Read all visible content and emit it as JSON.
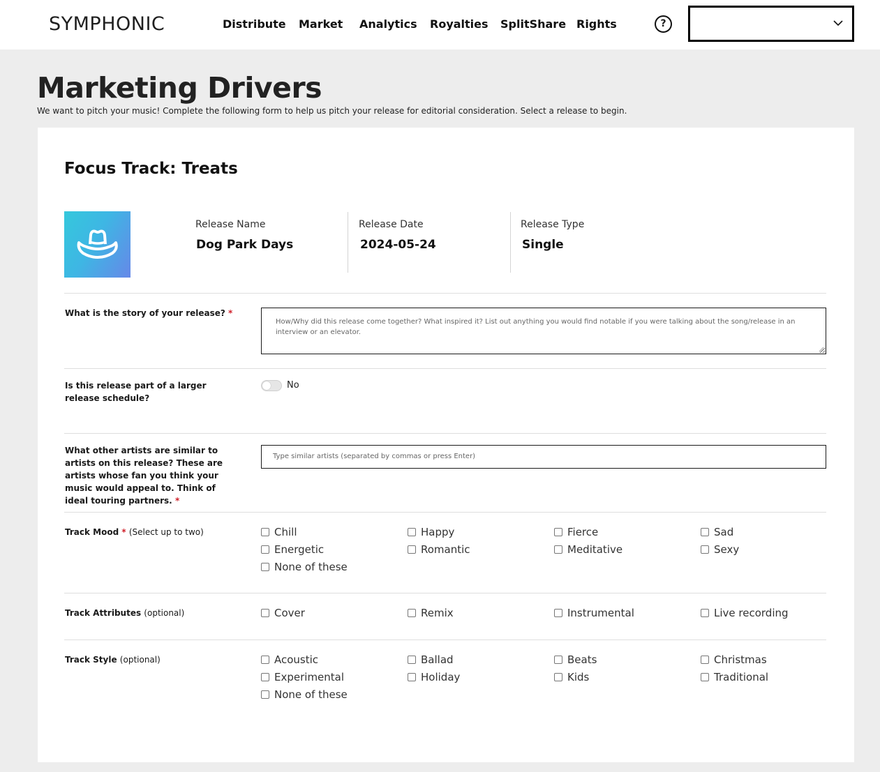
{
  "header": {
    "logo": "SYMPHONIC",
    "nav": [
      "Distribute",
      "Market",
      "Analytics",
      "Royalties",
      "SplitShare",
      "Rights"
    ],
    "help_label": "?",
    "account_select_value": ""
  },
  "page": {
    "title": "Marketing Drivers",
    "subtitle": "We want to pitch your music! Complete the following form to help us pitch your release for editorial consideration. Select a release to begin."
  },
  "focus": {
    "title": "Focus Track: Treats",
    "art_icon": "cowboy-hat-icon",
    "art_colors": [
      "#35c8dc",
      "#6688e8"
    ],
    "release_name_label": "Release Name",
    "release_name": "Dog Park Days",
    "release_date_label": "Release Date",
    "release_date": "2024-05-24",
    "release_type_label": "Release Type",
    "release_type": "Single"
  },
  "form": {
    "story": {
      "label": "What is the story of your release?",
      "required": "*",
      "placeholder": "How/Why did this release come together? What inspired it? List out anything you would find notable if you were talking about the song/release in an interview or an elevator."
    },
    "schedule": {
      "label": "Is this release part of a larger release schedule?",
      "toggle_state": false,
      "toggle_text": "No"
    },
    "artists": {
      "label": "What other artists are similar to artists on this release? These are artists whose fan you think your music would appeal to. Think of ideal touring partners.",
      "required": "*",
      "placeholder": "Type similar artists (separated by commas or press Enter)"
    },
    "mood": {
      "label": "Track Mood",
      "required": "*",
      "note": "(Select up to two)",
      "options": [
        "Chill",
        "Happy",
        "Fierce",
        "Sad",
        "Energetic",
        "Romantic",
        "Meditative",
        "Sexy",
        "None of these"
      ]
    },
    "attributes": {
      "label": "Track Attributes",
      "note": "(optional)",
      "options": [
        "Cover",
        "Remix",
        "Instrumental",
        "Live recording"
      ]
    },
    "style": {
      "label": "Track Style",
      "note": "(optional)",
      "options": [
        "Acoustic",
        "Ballad",
        "Beats",
        "Christmas",
        "Experimental",
        "Holiday",
        "Kids",
        "Traditional",
        "None of these"
      ]
    }
  },
  "colors": {
    "required": "#d0202a",
    "page_bg": "#ededed"
  }
}
